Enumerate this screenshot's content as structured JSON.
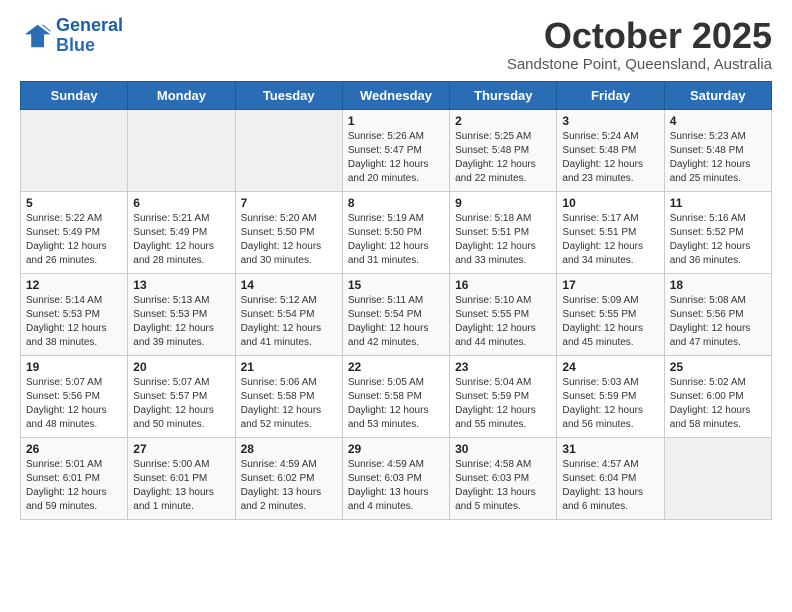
{
  "header": {
    "logo_line1": "General",
    "logo_line2": "Blue",
    "month": "October 2025",
    "location": "Sandstone Point, Queensland, Australia"
  },
  "weekdays": [
    "Sunday",
    "Monday",
    "Tuesday",
    "Wednesday",
    "Thursday",
    "Friday",
    "Saturday"
  ],
  "weeks": [
    [
      {
        "day": "",
        "info": ""
      },
      {
        "day": "",
        "info": ""
      },
      {
        "day": "",
        "info": ""
      },
      {
        "day": "1",
        "info": "Sunrise: 5:26 AM\nSunset: 5:47 PM\nDaylight: 12 hours\nand 20 minutes."
      },
      {
        "day": "2",
        "info": "Sunrise: 5:25 AM\nSunset: 5:48 PM\nDaylight: 12 hours\nand 22 minutes."
      },
      {
        "day": "3",
        "info": "Sunrise: 5:24 AM\nSunset: 5:48 PM\nDaylight: 12 hours\nand 23 minutes."
      },
      {
        "day": "4",
        "info": "Sunrise: 5:23 AM\nSunset: 5:48 PM\nDaylight: 12 hours\nand 25 minutes."
      }
    ],
    [
      {
        "day": "5",
        "info": "Sunrise: 5:22 AM\nSunset: 5:49 PM\nDaylight: 12 hours\nand 26 minutes."
      },
      {
        "day": "6",
        "info": "Sunrise: 5:21 AM\nSunset: 5:49 PM\nDaylight: 12 hours\nand 28 minutes."
      },
      {
        "day": "7",
        "info": "Sunrise: 5:20 AM\nSunset: 5:50 PM\nDaylight: 12 hours\nand 30 minutes."
      },
      {
        "day": "8",
        "info": "Sunrise: 5:19 AM\nSunset: 5:50 PM\nDaylight: 12 hours\nand 31 minutes."
      },
      {
        "day": "9",
        "info": "Sunrise: 5:18 AM\nSunset: 5:51 PM\nDaylight: 12 hours\nand 33 minutes."
      },
      {
        "day": "10",
        "info": "Sunrise: 5:17 AM\nSunset: 5:51 PM\nDaylight: 12 hours\nand 34 minutes."
      },
      {
        "day": "11",
        "info": "Sunrise: 5:16 AM\nSunset: 5:52 PM\nDaylight: 12 hours\nand 36 minutes."
      }
    ],
    [
      {
        "day": "12",
        "info": "Sunrise: 5:14 AM\nSunset: 5:53 PM\nDaylight: 12 hours\nand 38 minutes."
      },
      {
        "day": "13",
        "info": "Sunrise: 5:13 AM\nSunset: 5:53 PM\nDaylight: 12 hours\nand 39 minutes."
      },
      {
        "day": "14",
        "info": "Sunrise: 5:12 AM\nSunset: 5:54 PM\nDaylight: 12 hours\nand 41 minutes."
      },
      {
        "day": "15",
        "info": "Sunrise: 5:11 AM\nSunset: 5:54 PM\nDaylight: 12 hours\nand 42 minutes."
      },
      {
        "day": "16",
        "info": "Sunrise: 5:10 AM\nSunset: 5:55 PM\nDaylight: 12 hours\nand 44 minutes."
      },
      {
        "day": "17",
        "info": "Sunrise: 5:09 AM\nSunset: 5:55 PM\nDaylight: 12 hours\nand 45 minutes."
      },
      {
        "day": "18",
        "info": "Sunrise: 5:08 AM\nSunset: 5:56 PM\nDaylight: 12 hours\nand 47 minutes."
      }
    ],
    [
      {
        "day": "19",
        "info": "Sunrise: 5:07 AM\nSunset: 5:56 PM\nDaylight: 12 hours\nand 48 minutes."
      },
      {
        "day": "20",
        "info": "Sunrise: 5:07 AM\nSunset: 5:57 PM\nDaylight: 12 hours\nand 50 minutes."
      },
      {
        "day": "21",
        "info": "Sunrise: 5:06 AM\nSunset: 5:58 PM\nDaylight: 12 hours\nand 52 minutes."
      },
      {
        "day": "22",
        "info": "Sunrise: 5:05 AM\nSunset: 5:58 PM\nDaylight: 12 hours\nand 53 minutes."
      },
      {
        "day": "23",
        "info": "Sunrise: 5:04 AM\nSunset: 5:59 PM\nDaylight: 12 hours\nand 55 minutes."
      },
      {
        "day": "24",
        "info": "Sunrise: 5:03 AM\nSunset: 5:59 PM\nDaylight: 12 hours\nand 56 minutes."
      },
      {
        "day": "25",
        "info": "Sunrise: 5:02 AM\nSunset: 6:00 PM\nDaylight: 12 hours\nand 58 minutes."
      }
    ],
    [
      {
        "day": "26",
        "info": "Sunrise: 5:01 AM\nSunset: 6:01 PM\nDaylight: 12 hours\nand 59 minutes."
      },
      {
        "day": "27",
        "info": "Sunrise: 5:00 AM\nSunset: 6:01 PM\nDaylight: 13 hours\nand 1 minute."
      },
      {
        "day": "28",
        "info": "Sunrise: 4:59 AM\nSunset: 6:02 PM\nDaylight: 13 hours\nand 2 minutes."
      },
      {
        "day": "29",
        "info": "Sunrise: 4:59 AM\nSunset: 6:03 PM\nDaylight: 13 hours\nand 4 minutes."
      },
      {
        "day": "30",
        "info": "Sunrise: 4:58 AM\nSunset: 6:03 PM\nDaylight: 13 hours\nand 5 minutes."
      },
      {
        "day": "31",
        "info": "Sunrise: 4:57 AM\nSunset: 6:04 PM\nDaylight: 13 hours\nand 6 minutes."
      },
      {
        "day": "",
        "info": ""
      }
    ]
  ]
}
